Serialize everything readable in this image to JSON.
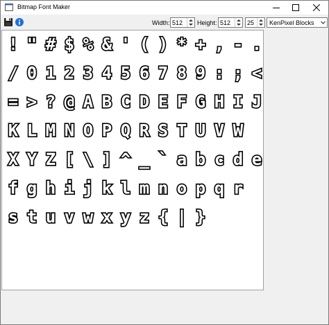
{
  "window": {
    "title": "Bitmap Font Maker"
  },
  "toolbar": {
    "save_icon": "save-icon",
    "info_icon": "info-icon",
    "width_label": "Width:",
    "width_value": "512",
    "height_label": "Height:",
    "height_value": "512",
    "size_value": "25",
    "font_selected": "KenPixel Blocks"
  },
  "canvas": {
    "glyph_rows": [
      [
        "!",
        "\"",
        "#",
        "$",
        "%",
        "&",
        "'",
        "(",
        ")",
        "*",
        "+",
        ",",
        "-",
        "."
      ],
      [
        "/",
        "0",
        "1",
        "2",
        "3",
        "4",
        "5",
        "6",
        "7",
        "8",
        "9",
        ":",
        ";",
        "<"
      ],
      [
        "=",
        ">",
        "?",
        "@",
        "A",
        "B",
        "C",
        "D",
        "E",
        "F",
        "G",
        "H",
        "I",
        "J"
      ],
      [
        "K",
        "L",
        "M",
        "N",
        "O",
        "P",
        "Q",
        "R",
        "S",
        "T",
        "U",
        "V",
        "W"
      ],
      [
        "X",
        "Y",
        "Z",
        "[",
        "\\",
        "]",
        "^",
        "_",
        "`",
        "a",
        "b",
        "c",
        "d",
        "e"
      ],
      [
        "f",
        "g",
        "h",
        "i",
        "j",
        "k",
        "l",
        "m",
        "n",
        "o",
        "p",
        "q",
        "r"
      ],
      [
        "s",
        "t",
        "u",
        "v",
        "w",
        "x",
        "y",
        "z",
        "{",
        "|",
        "}"
      ]
    ]
  }
}
